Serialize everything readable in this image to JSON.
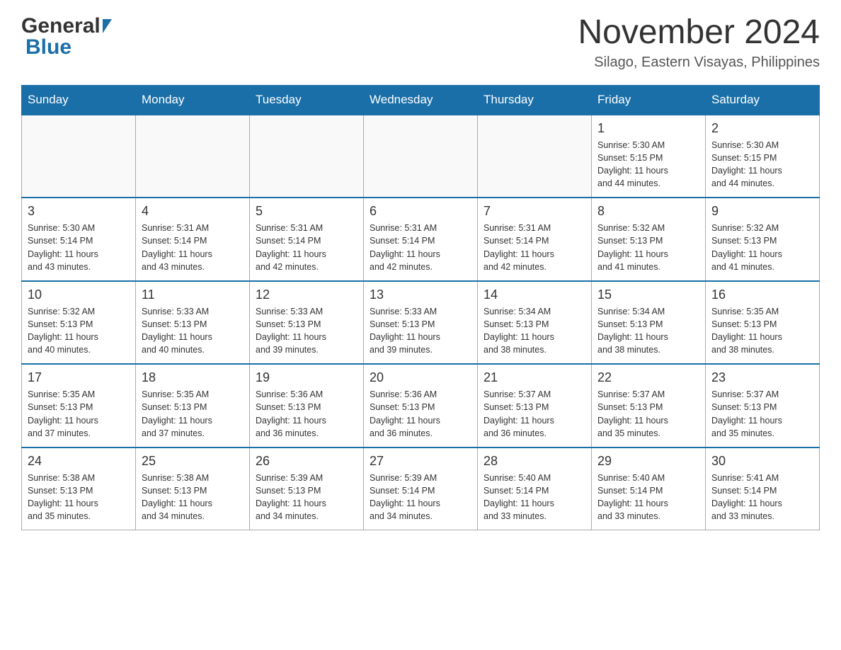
{
  "header": {
    "logo_general": "General",
    "logo_blue": "Blue",
    "month_title": "November 2024",
    "subtitle": "Silago, Eastern Visayas, Philippines"
  },
  "weekdays": [
    "Sunday",
    "Monday",
    "Tuesday",
    "Wednesday",
    "Thursday",
    "Friday",
    "Saturday"
  ],
  "weeks": [
    {
      "days": [
        {
          "number": "",
          "info": ""
        },
        {
          "number": "",
          "info": ""
        },
        {
          "number": "",
          "info": ""
        },
        {
          "number": "",
          "info": ""
        },
        {
          "number": "",
          "info": ""
        },
        {
          "number": "1",
          "info": "Sunrise: 5:30 AM\nSunset: 5:15 PM\nDaylight: 11 hours\nand 44 minutes."
        },
        {
          "number": "2",
          "info": "Sunrise: 5:30 AM\nSunset: 5:15 PM\nDaylight: 11 hours\nand 44 minutes."
        }
      ]
    },
    {
      "days": [
        {
          "number": "3",
          "info": "Sunrise: 5:30 AM\nSunset: 5:14 PM\nDaylight: 11 hours\nand 43 minutes."
        },
        {
          "number": "4",
          "info": "Sunrise: 5:31 AM\nSunset: 5:14 PM\nDaylight: 11 hours\nand 43 minutes."
        },
        {
          "number": "5",
          "info": "Sunrise: 5:31 AM\nSunset: 5:14 PM\nDaylight: 11 hours\nand 42 minutes."
        },
        {
          "number": "6",
          "info": "Sunrise: 5:31 AM\nSunset: 5:14 PM\nDaylight: 11 hours\nand 42 minutes."
        },
        {
          "number": "7",
          "info": "Sunrise: 5:31 AM\nSunset: 5:14 PM\nDaylight: 11 hours\nand 42 minutes."
        },
        {
          "number": "8",
          "info": "Sunrise: 5:32 AM\nSunset: 5:13 PM\nDaylight: 11 hours\nand 41 minutes."
        },
        {
          "number": "9",
          "info": "Sunrise: 5:32 AM\nSunset: 5:13 PM\nDaylight: 11 hours\nand 41 minutes."
        }
      ]
    },
    {
      "days": [
        {
          "number": "10",
          "info": "Sunrise: 5:32 AM\nSunset: 5:13 PM\nDaylight: 11 hours\nand 40 minutes."
        },
        {
          "number": "11",
          "info": "Sunrise: 5:33 AM\nSunset: 5:13 PM\nDaylight: 11 hours\nand 40 minutes."
        },
        {
          "number": "12",
          "info": "Sunrise: 5:33 AM\nSunset: 5:13 PM\nDaylight: 11 hours\nand 39 minutes."
        },
        {
          "number": "13",
          "info": "Sunrise: 5:33 AM\nSunset: 5:13 PM\nDaylight: 11 hours\nand 39 minutes."
        },
        {
          "number": "14",
          "info": "Sunrise: 5:34 AM\nSunset: 5:13 PM\nDaylight: 11 hours\nand 38 minutes."
        },
        {
          "number": "15",
          "info": "Sunrise: 5:34 AM\nSunset: 5:13 PM\nDaylight: 11 hours\nand 38 minutes."
        },
        {
          "number": "16",
          "info": "Sunrise: 5:35 AM\nSunset: 5:13 PM\nDaylight: 11 hours\nand 38 minutes."
        }
      ]
    },
    {
      "days": [
        {
          "number": "17",
          "info": "Sunrise: 5:35 AM\nSunset: 5:13 PM\nDaylight: 11 hours\nand 37 minutes."
        },
        {
          "number": "18",
          "info": "Sunrise: 5:35 AM\nSunset: 5:13 PM\nDaylight: 11 hours\nand 37 minutes."
        },
        {
          "number": "19",
          "info": "Sunrise: 5:36 AM\nSunset: 5:13 PM\nDaylight: 11 hours\nand 36 minutes."
        },
        {
          "number": "20",
          "info": "Sunrise: 5:36 AM\nSunset: 5:13 PM\nDaylight: 11 hours\nand 36 minutes."
        },
        {
          "number": "21",
          "info": "Sunrise: 5:37 AM\nSunset: 5:13 PM\nDaylight: 11 hours\nand 36 minutes."
        },
        {
          "number": "22",
          "info": "Sunrise: 5:37 AM\nSunset: 5:13 PM\nDaylight: 11 hours\nand 35 minutes."
        },
        {
          "number": "23",
          "info": "Sunrise: 5:37 AM\nSunset: 5:13 PM\nDaylight: 11 hours\nand 35 minutes."
        }
      ]
    },
    {
      "days": [
        {
          "number": "24",
          "info": "Sunrise: 5:38 AM\nSunset: 5:13 PM\nDaylight: 11 hours\nand 35 minutes."
        },
        {
          "number": "25",
          "info": "Sunrise: 5:38 AM\nSunset: 5:13 PM\nDaylight: 11 hours\nand 34 minutes."
        },
        {
          "number": "26",
          "info": "Sunrise: 5:39 AM\nSunset: 5:13 PM\nDaylight: 11 hours\nand 34 minutes."
        },
        {
          "number": "27",
          "info": "Sunrise: 5:39 AM\nSunset: 5:14 PM\nDaylight: 11 hours\nand 34 minutes."
        },
        {
          "number": "28",
          "info": "Sunrise: 5:40 AM\nSunset: 5:14 PM\nDaylight: 11 hours\nand 33 minutes."
        },
        {
          "number": "29",
          "info": "Sunrise: 5:40 AM\nSunset: 5:14 PM\nDaylight: 11 hours\nand 33 minutes."
        },
        {
          "number": "30",
          "info": "Sunrise: 5:41 AM\nSunset: 5:14 PM\nDaylight: 11 hours\nand 33 minutes."
        }
      ]
    }
  ]
}
